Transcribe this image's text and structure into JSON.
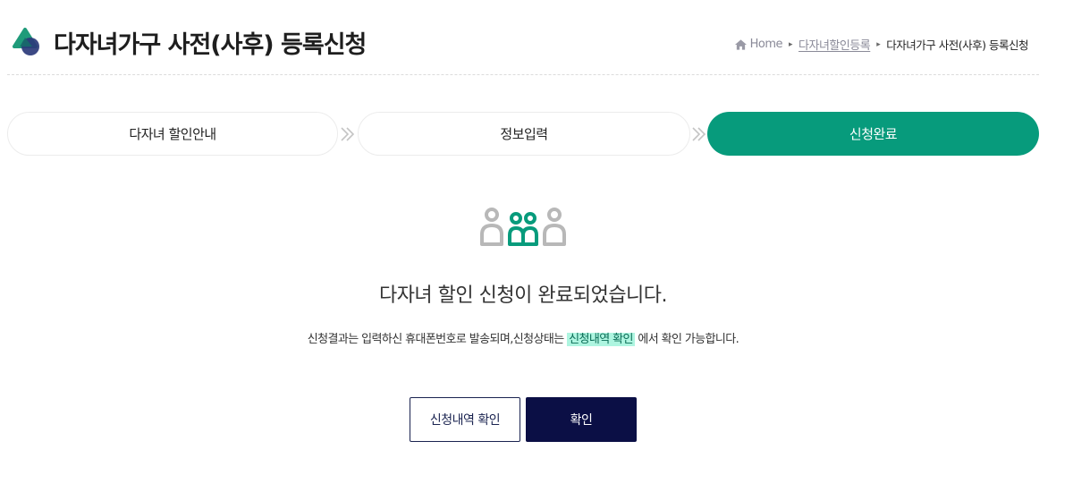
{
  "header": {
    "title": "다자녀가구 사전(사후) 등록신청"
  },
  "breadcrumb": {
    "home": "Home",
    "separator": "▸",
    "items": [
      "다자녀할인등록",
      "다자녀가구 사전(사후) 등록신청"
    ]
  },
  "steps": [
    {
      "label": "다자녀 할인안내",
      "state": "inactive"
    },
    {
      "label": "정보입력",
      "state": "inactive"
    },
    {
      "label": "신청완료",
      "state": "active"
    }
  ],
  "completion": {
    "title": "다자녀 할인 신청이 완료되었습니다.",
    "desc_before": "신청결과는 입력하신 휴대폰번호로 발송되며,신청상태는 ",
    "desc_highlight": "신청내역 확인",
    "desc_after": " 에서 확인 가능합니다."
  },
  "buttons": {
    "history_label": "신청내역 확인",
    "confirm_label": "확인"
  },
  "colors": {
    "accent_green": "#079b7c",
    "navy": "#0b0f45",
    "highlight_bg": "#aef5e0",
    "icon_gray": "#b8b8b8"
  },
  "icons": {
    "logo": "brand-logo-icon",
    "home": "home-icon",
    "step_arrow": "double-chevron-right-icon",
    "people": "family-people-icon"
  }
}
